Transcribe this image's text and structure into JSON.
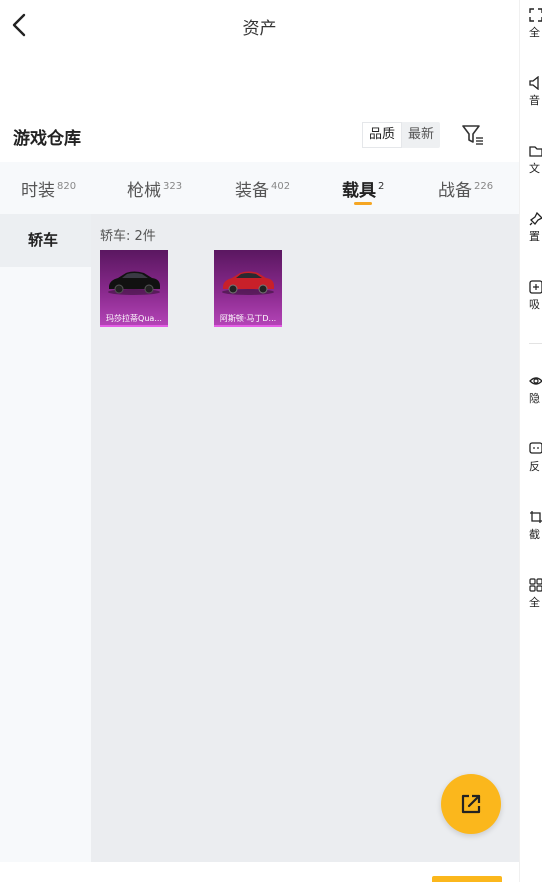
{
  "header": {
    "title": "资产"
  },
  "section": {
    "title": "游戏仓库",
    "sort_options": [
      "品质",
      "最新"
    ]
  },
  "tabs": [
    {
      "label": "时装",
      "count": "820"
    },
    {
      "label": "枪械",
      "count": "323"
    },
    {
      "label": "装备",
      "count": "402"
    },
    {
      "label": "载具",
      "count": "2"
    },
    {
      "label": "战备",
      "count": "226"
    }
  ],
  "active_tab": "载具",
  "sidebar": {
    "items": [
      {
        "label": "轿车"
      }
    ]
  },
  "content": {
    "group_label": "轿车: 2件",
    "items": [
      {
        "name": "玛莎拉蒂Qua...",
        "car_color": "#111111"
      },
      {
        "name": "阿斯顿·马丁D...",
        "car_color": "#c8202a"
      }
    ]
  },
  "right_toolbar": {
    "items": [
      {
        "label": "全",
        "icon": "fullscreen-icon"
      },
      {
        "label": "音",
        "icon": "sound-icon"
      },
      {
        "label": "文",
        "icon": "folder-icon"
      },
      {
        "label": "置",
        "icon": "pin-icon"
      },
      {
        "label": "吸",
        "icon": "attach-icon"
      },
      {
        "label": "隐",
        "icon": "eye-icon"
      },
      {
        "label": "反",
        "icon": "feedback-icon"
      },
      {
        "label": "截",
        "icon": "screenshot-icon"
      },
      {
        "label": "全",
        "icon": "apps-icon"
      }
    ]
  },
  "colors": {
    "accent": "#fbb71c",
    "card_purple": "#8a2a8e"
  }
}
